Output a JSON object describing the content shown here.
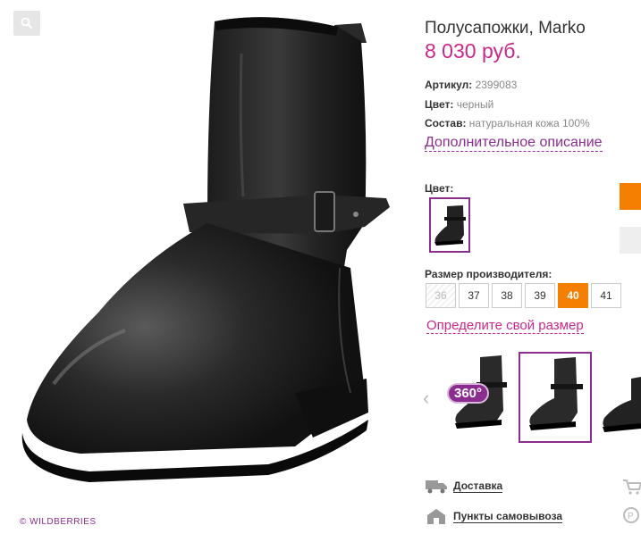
{
  "product": {
    "title": "Полусапожки, Marko",
    "price": "8 030 руб.",
    "attributes": [
      {
        "label": "Артикул:",
        "value": "2399083"
      },
      {
        "label": "Цвет:",
        "value": "черный"
      },
      {
        "label": "Состав:",
        "value": "натуральная кожа 100%"
      }
    ],
    "more_link": "Дополнительное описание"
  },
  "color_section": {
    "label": "Цвет:"
  },
  "size_section": {
    "label": "Размер производителя:",
    "sizes": [
      "36",
      "37",
      "38",
      "39",
      "40",
      "41"
    ],
    "disabled": [
      "36"
    ],
    "selected": "40",
    "size_link": "Определите свой размер"
  },
  "gallery": {
    "badge_360": "360°"
  },
  "services": {
    "delivery": "Доставка",
    "pickup": "Пункты самовывоза"
  },
  "watermark": "© WILDBERRIES",
  "colors": {
    "accent": "#8b2d8f",
    "price": "#c9288a",
    "selected_size": "#f57f00"
  },
  "icons": [
    "search-icon",
    "chevron-left-icon",
    "truck-icon",
    "pickup-point-icon"
  ]
}
